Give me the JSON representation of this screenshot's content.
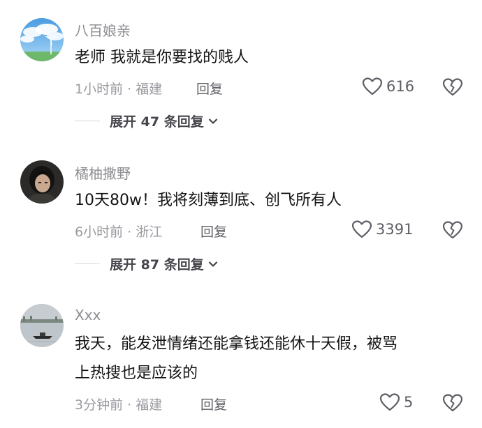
{
  "comments": [
    {
      "username": "八百娘亲",
      "text_lines": [
        "老师 我就是你要找的贱人"
      ],
      "time": "1小时前",
      "location": "福建",
      "reply_label": "回复",
      "likes": "616",
      "expand": {
        "prefix": "展开",
        "count": "47",
        "suffix": "条回复"
      }
    },
    {
      "username": "橘柚撒野",
      "text_lines": [
        "10天80w！我将刻薄到底、创飞所有人"
      ],
      "time": "6小时前",
      "location": "浙江",
      "reply_label": "回复",
      "likes": "3391",
      "expand": {
        "prefix": "展开",
        "count": "87",
        "suffix": "条回复"
      }
    },
    {
      "username": "Xxx",
      "text_lines": [
        "我天，能发泄情绪还能拿钱还能休十天假，被骂",
        "上热搜也是应该的"
      ],
      "time": "3分钟前",
      "location": "福建",
      "reply_label": "回复",
      "likes": "5"
    }
  ],
  "separator": " · ",
  "icons": {
    "like": "heart-outline-icon",
    "dislike": "broken-heart-icon",
    "expand": "chevron-down-icon"
  }
}
